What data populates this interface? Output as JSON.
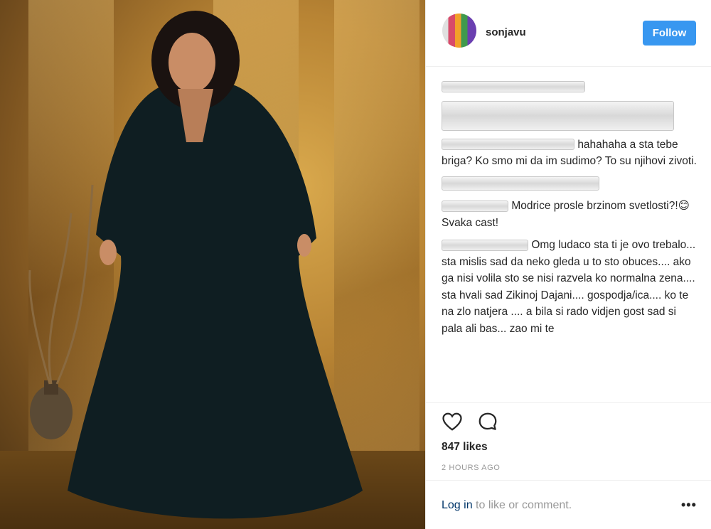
{
  "post": {
    "username": "sonjavu",
    "follow_label": "Follow",
    "likes": "847 likes",
    "time": "2 HOURS AGO",
    "login_link": "Log in",
    "login_suffix": " to like or comment.",
    "more": "•••"
  },
  "comments": [
    {
      "text": ""
    },
    {
      "text": ""
    },
    {
      "text": "hahahaha a sta tebe briga? Ko smo mi da im sudimo? To su njihovi zivoti."
    },
    {
      "text": ""
    },
    {
      "text": "Modrice prosle brzinom svetlosti?!😊 Svaka cast!"
    },
    {
      "text": "Omg ludaco sta ti je ovo trebalo... sta mislis sad da neko gleda u to sto obuces.... ako ga nisi volila sto se nisi razvela ko normalna zena.... sta hvali sad Zikinoj Dajani.... gospodja/ica.... ko te na zlo natjera .... a bila si rado vidjen gost sad si pala ali bas... zao mi te"
    }
  ],
  "icons": {
    "heart": "heart-icon",
    "comment": "comment-icon",
    "more": "more-icon"
  },
  "colors": {
    "follow_bg": "#3897f0",
    "link": "#003569",
    "muted": "#999999"
  }
}
